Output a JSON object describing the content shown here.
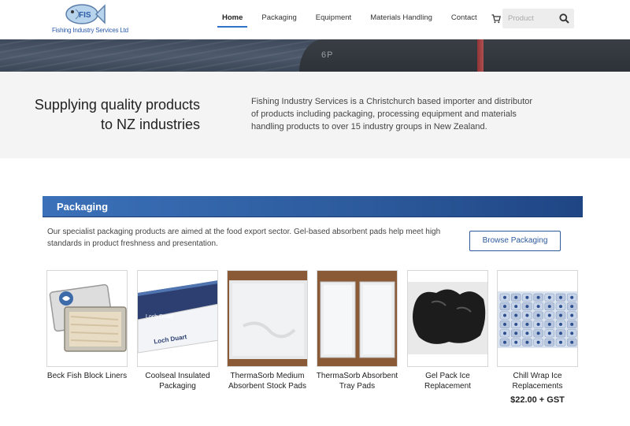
{
  "header": {
    "logo_text": "Fishing Industry Services Ltd",
    "nav": [
      {
        "label": "Home",
        "active": true
      },
      {
        "label": "Packaging",
        "active": false
      },
      {
        "label": "Equipment",
        "active": false
      },
      {
        "label": "Materials Handling",
        "active": false
      },
      {
        "label": "Contact",
        "active": false
      }
    ],
    "icons": [
      "cart-icon",
      "account-icon"
    ],
    "search": {
      "placeholder": "Product",
      "value": ""
    }
  },
  "hero": {
    "boat_marking": "6P"
  },
  "intro": {
    "title": "Supplying quality products to NZ industries",
    "text": "Fishing Industry Services is a Christchurch based importer and distributor of products including packaging, processing equipment and materials handling products to over 15 industry groups in New Zealand."
  },
  "packaging": {
    "heading": "Packaging",
    "description": "Our specialist packaging products are aimed at the food export sector. Gel-based absorbent pads help meet high standards in product freshness and presentation.",
    "browse_label": "Browse Packaging",
    "products": [
      {
        "name": "Beck Fish Block Liners",
        "price": ""
      },
      {
        "name": "Coolseal Insulated Packaging",
        "price": ""
      },
      {
        "name": "ThermaSorb Medium Absorbent Stock Pads",
        "price": ""
      },
      {
        "name": "ThermaSorb Absorbent Tray Pads",
        "price": ""
      },
      {
        "name": "Gel Pack Ice Replacement",
        "price": ""
      },
      {
        "name": "Chill Wrap Ice Replacements",
        "price": "$22.00 + GST"
      }
    ],
    "box_label": "Loch Duart"
  },
  "colors": {
    "accent": "#2e73c7",
    "section_bar": "#2c5a9c",
    "intro_bg": "#f4f4f4"
  }
}
